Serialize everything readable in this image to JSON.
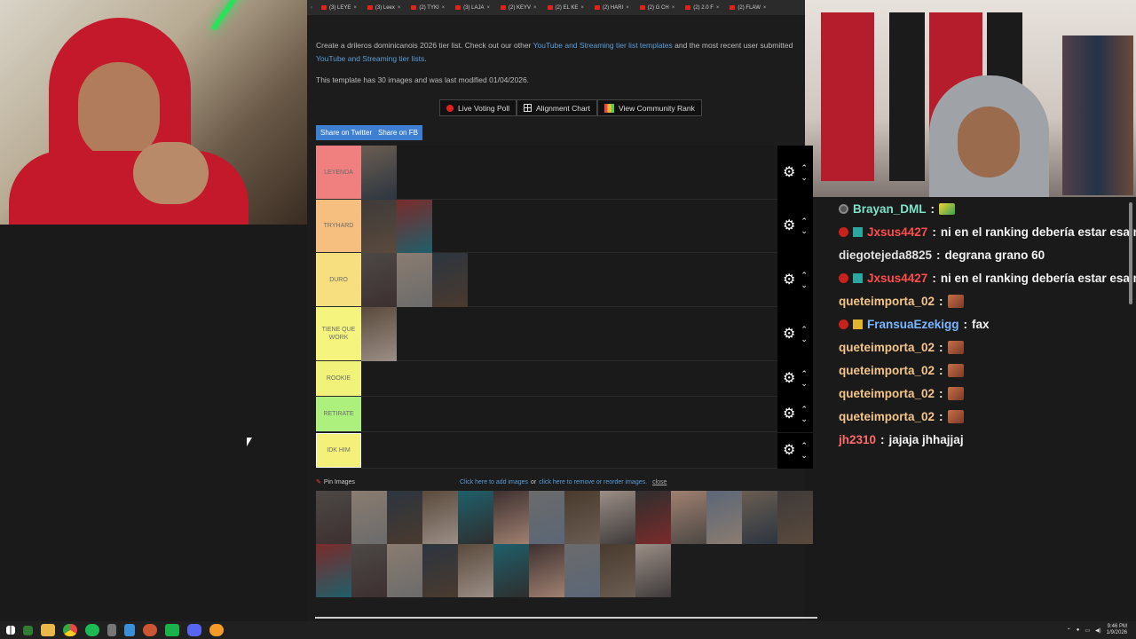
{
  "browser": {
    "tabs": [
      {
        "label": "(3) LEYE"
      },
      {
        "label": "(3) Leex"
      },
      {
        "label": "(2) TYKI"
      },
      {
        "label": "(3) LAJA"
      },
      {
        "label": "(2) KEYV"
      },
      {
        "label": "(2) EL KE"
      },
      {
        "label": "(2) HARI"
      },
      {
        "label": "(2) G CH"
      },
      {
        "label": "(2) 2.0 F"
      },
      {
        "label": "(2) FLAW"
      }
    ]
  },
  "intro": {
    "line_start": "Create a drileros dominicanois 2026 tier list. Check out our other ",
    "link1": "YouTube and Streaming tier list templates",
    "line_mid": " and the most recent user submitted ",
    "link2": "YouTube and Streaming tier lists",
    "line_end": ".",
    "meta": "This template has 30 images and was last modified 01/04/2026."
  },
  "toolbar": {
    "live_poll": "Live Voting Poll",
    "alignment": "Alignment Chart",
    "community": "View Community Rank",
    "share_twitter": "Share on Twitter",
    "share_fb": "Share on FB"
  },
  "tiers": [
    {
      "label": "LEYENDA",
      "color": "#f07f7f",
      "count": 1
    },
    {
      "label": "TRYHARD",
      "color": "#f6bf7f",
      "count": 2
    },
    {
      "label": "DURO",
      "color": "#f7de7f",
      "count": 3
    },
    {
      "label": "TIENE QUE WORK",
      "color": "#f5f47f",
      "count": 1
    },
    {
      "label": "ROOKIE",
      "color": "#f0f27a",
      "count": 0
    },
    {
      "label": "RETIRATE",
      "color": "#aef07d",
      "count": 0
    },
    {
      "label": "IDK HIM",
      "color": "#f4f07a",
      "count": 0
    }
  ],
  "pin": {
    "label": "Pin Images",
    "add": "Click here to add images",
    "or": "or",
    "remove": "click here to remove or reorder images.",
    "close": "close"
  },
  "chat": [
    {
      "user": "Brayan_DML",
      "text": "",
      "color": "#7fe2c8",
      "badges": [
        "gray"
      ],
      "emote": "yellow"
    },
    {
      "user": "Jxsus4427",
      "text": "ni en el ranking debería estar esa m",
      "color": "#ff4d4d",
      "badges": [
        "red",
        "teal"
      ]
    },
    {
      "user": "diegotejeda8825",
      "text": "degrana grano 60",
      "color": "#e0e0e0",
      "badges": []
    },
    {
      "user": "Jxsus4427",
      "text": "ni en el ranking debería estar esa m",
      "color": "#ff4d4d",
      "badges": [
        "red",
        "teal"
      ]
    },
    {
      "user": "queteimporta_02",
      "text": "",
      "color": "#f4c58a",
      "badges": [],
      "emote": "face"
    },
    {
      "user": "FransuaEzekigg",
      "text": "fax",
      "color": "#7ab6ff",
      "badges": [
        "red",
        "gold"
      ]
    },
    {
      "user": "queteimporta_02",
      "text": "",
      "color": "#f4c58a",
      "badges": [],
      "emote": "face"
    },
    {
      "user": "queteimporta_02",
      "text": "",
      "color": "#f4c58a",
      "badges": [],
      "emote": "face"
    },
    {
      "user": "queteimporta_02",
      "text": "",
      "color": "#f4c58a",
      "badges": [],
      "emote": "face"
    },
    {
      "user": "queteimporta_02",
      "text": "",
      "color": "#f4c58a",
      "badges": [],
      "emote": "face"
    },
    {
      "user": "jh2310",
      "text": "jajaja jhhajjaj",
      "color": "#ff6a6a",
      "badges": []
    }
  ],
  "taskbar": {
    "time": "9:46 PM",
    "date": "1/9/2026"
  }
}
